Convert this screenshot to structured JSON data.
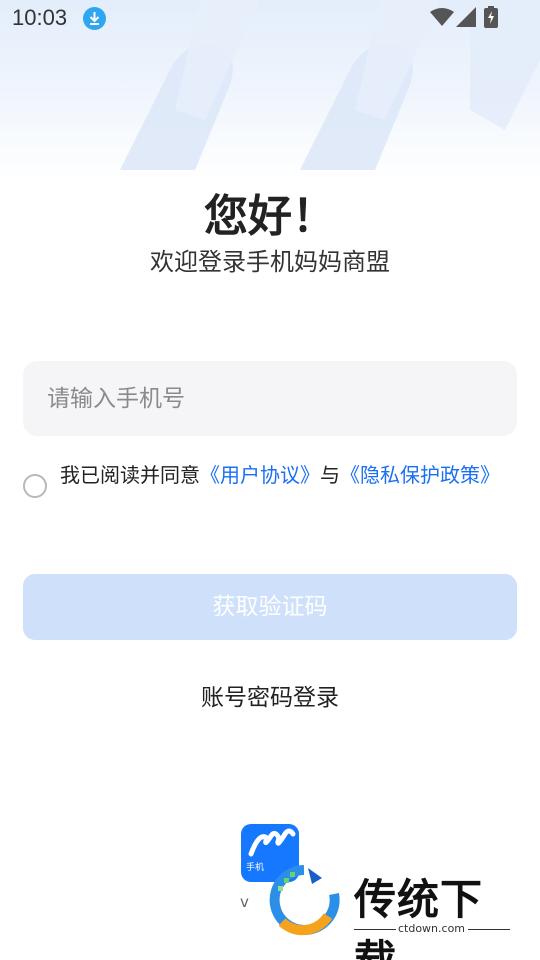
{
  "status_bar": {
    "time": "10:03"
  },
  "header": {
    "greeting": "您好！",
    "welcome": "欢迎登录手机妈妈商盟"
  },
  "login_form": {
    "phone_placeholder": "请输入手机号",
    "agreement_prefix": "我已阅读并同意",
    "user_agreement_link": "《用户协议》",
    "agreement_connector": "与",
    "privacy_policy_link": "《隐私保护政策》",
    "get_code_button": "获取验证码",
    "password_login_link": "账号密码登录"
  },
  "footer": {
    "app_logo_label": "手机",
    "version_prefix": "v"
  },
  "watermark": {
    "title": "传统下载",
    "subtitle": "ctdown.com"
  },
  "colors": {
    "accent": "#1b6ff5",
    "button_disabled": "#cfe0fb",
    "input_bg": "#f5f5f7"
  }
}
